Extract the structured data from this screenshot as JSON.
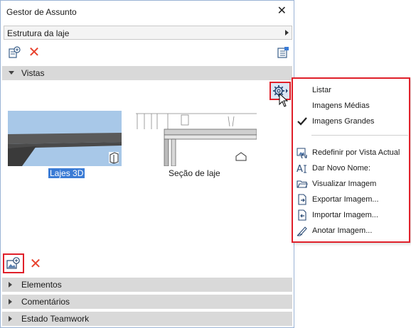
{
  "window": {
    "title": "Gestor de Assunto",
    "close_glyph": "✕"
  },
  "selector": {
    "value": "Estrutura da laje"
  },
  "toolbar": {
    "delete_glyph": "✕"
  },
  "sections": {
    "vistas": {
      "label": "Vistas",
      "expanded": true
    },
    "elementos": {
      "label": "Elementos",
      "expanded": false
    },
    "comentarios": {
      "label": "Comentários",
      "expanded": false
    },
    "teamwork": {
      "label": "Estado Teamwork",
      "expanded": false
    }
  },
  "views": [
    {
      "caption": "Lajes 3D",
      "selected": true,
      "icon": "3d-view-icon"
    },
    {
      "caption": "Seção de laje",
      "selected": false,
      "icon": "section-view-icon"
    }
  ],
  "menu": {
    "items": [
      {
        "label": "Listar",
        "icon": ""
      },
      {
        "label": "Imagens Médias",
        "icon": ""
      },
      {
        "label": "Imagens Grandes",
        "icon": "check-icon",
        "checked": true
      },
      {
        "label": "Redefinir por Vista Actual",
        "icon": "reset-view-icon"
      },
      {
        "label": "Dar Novo Nome:",
        "icon": "rename-icon"
      },
      {
        "label": "Visualizar Imagem",
        "icon": "open-folder-icon"
      },
      {
        "label": "Exportar Imagem...",
        "icon": "export-icon"
      },
      {
        "label": "Importar Imagem...",
        "icon": "import-icon"
      },
      {
        "label": "Anotar Imagem...",
        "icon": "annotate-icon"
      }
    ]
  },
  "colors": {
    "highlight_red": "#e0202a",
    "delete_red": "#e8412c",
    "selection_blue": "#3a7bd5",
    "header_gray": "#d9d9d9"
  }
}
